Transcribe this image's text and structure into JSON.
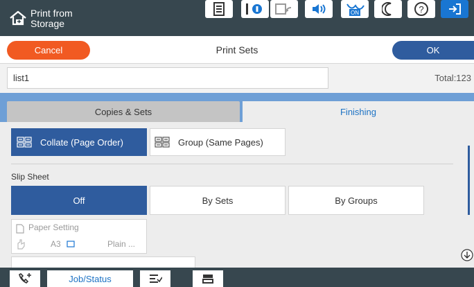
{
  "header": {
    "title_line1": "Print from",
    "title_line2": "Storage",
    "icons": [
      "home-icon",
      "document-icon",
      "info-icon",
      "wifi-icon",
      "volume-icon",
      "eco-on-icon",
      "sleep-icon",
      "help-icon",
      "exit-icon"
    ],
    "eco_label": "ON"
  },
  "actionbar": {
    "cancel_label": "Cancel",
    "title": "Print Sets",
    "ok_label": "OK"
  },
  "name_row": {
    "name_value": "list1",
    "total_label": "Total:123"
  },
  "tabs": [
    {
      "label": "Copies & Sets",
      "selected": false
    },
    {
      "label": "Finishing",
      "selected": true
    }
  ],
  "finishing": {
    "collate_options": [
      {
        "label": "Collate (Page Order)",
        "selected": true
      },
      {
        "label": "Group (Same Pages)",
        "selected": false
      }
    ],
    "slip_sheet_label": "Slip Sheet",
    "slip_sheet_options": [
      {
        "label": "Off",
        "selected": true
      },
      {
        "label": "By Sets",
        "selected": false
      },
      {
        "label": "By Groups",
        "selected": false
      }
    ],
    "paper_setting": {
      "title": "Paper Setting",
      "size": "A3",
      "type": "Plain ..."
    }
  },
  "bottombar": {
    "job_status_label": "Job/Status",
    "icons": [
      "fax-icon",
      "job-status",
      "job-list-icon",
      "stop-icon"
    ]
  },
  "colors": {
    "topbar": "#37474f",
    "cancel": "#f15a22",
    "ok": "#2f5c9e",
    "selected": "#2f5c9e",
    "tab_accent": "#6e9fd6"
  }
}
